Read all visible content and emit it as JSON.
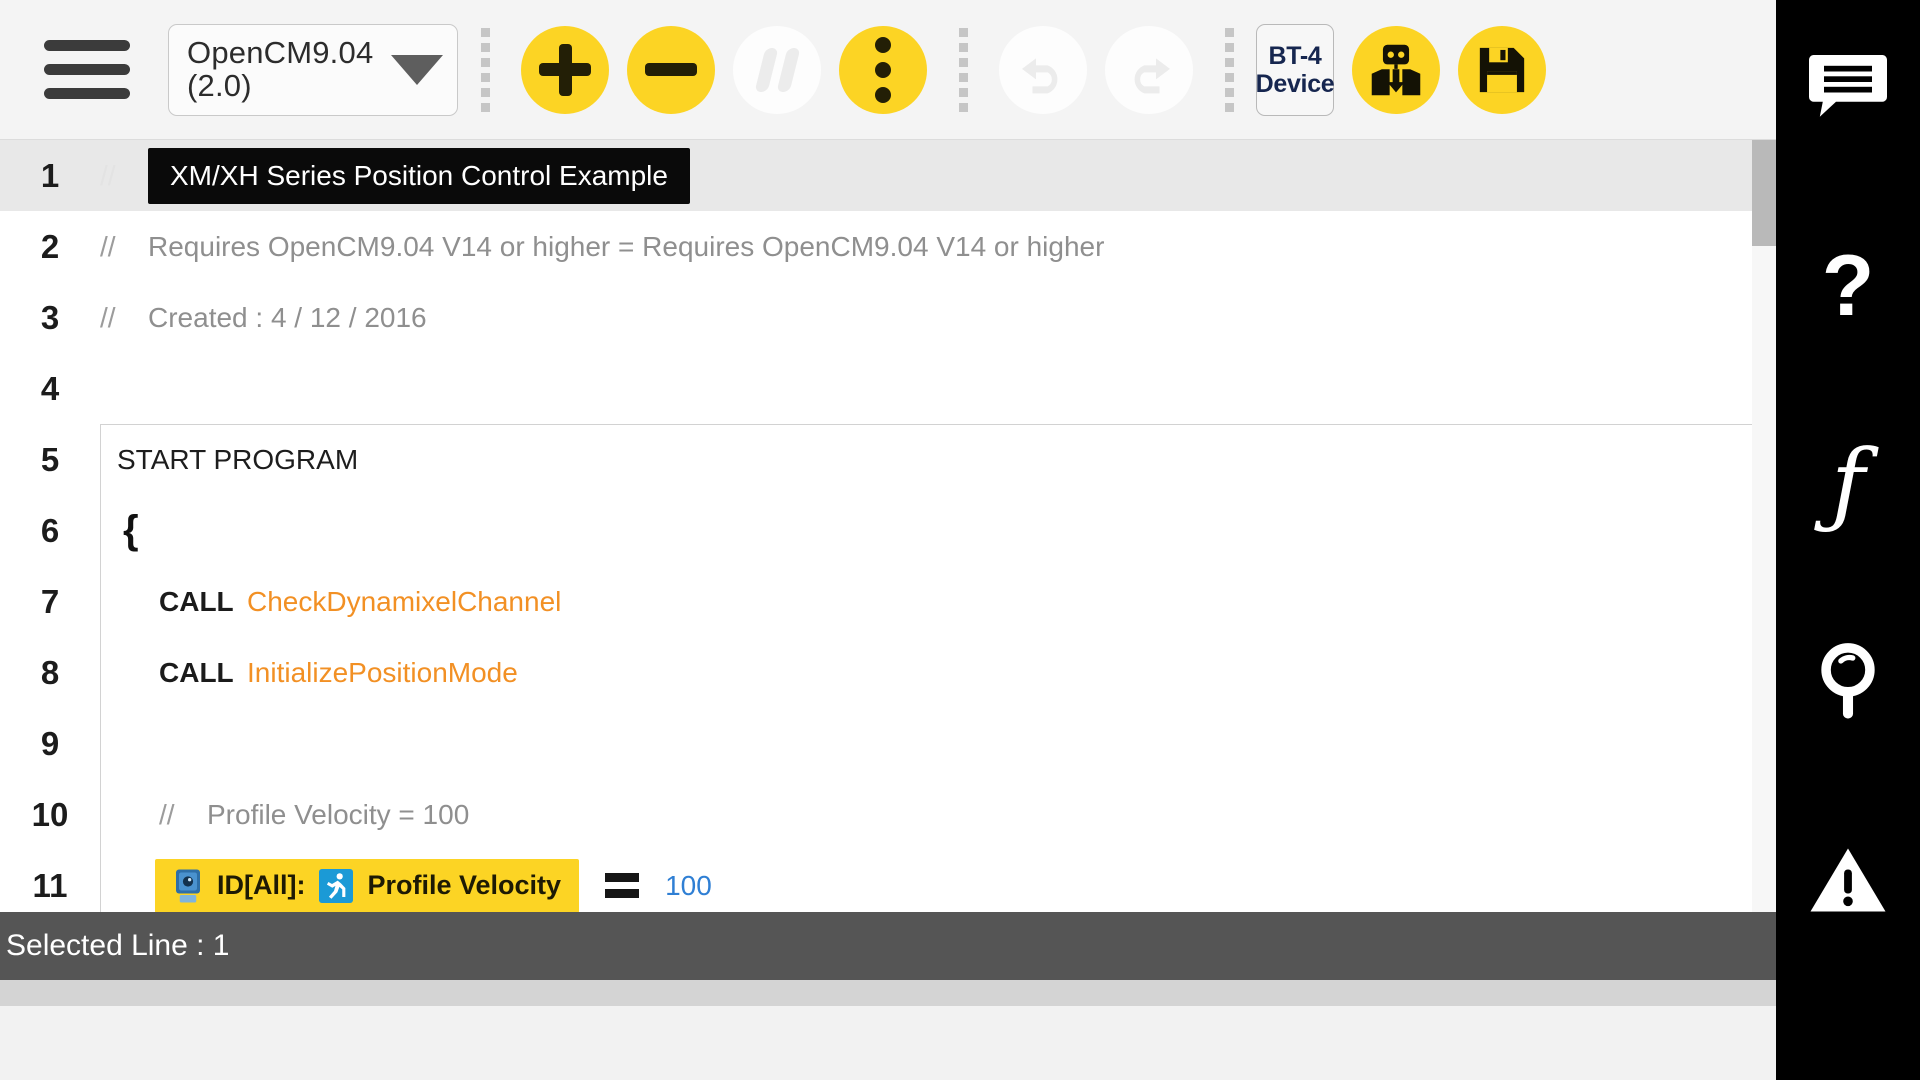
{
  "toolbar": {
    "menu_icon": "hamburger-menu-icon",
    "device": {
      "line1": "OpenCM9.04",
      "line2": "(2.0)",
      "caret_icon": "chevron-down-icon"
    },
    "buttons": [
      {
        "name": "add-line-button",
        "icon": "plus-icon",
        "state": "enabled"
      },
      {
        "name": "remove-line-button",
        "icon": "minus-icon",
        "state": "enabled"
      },
      {
        "name": "comment-line-button",
        "icon": "comment-slashes-icon",
        "state": "disabled"
      },
      {
        "name": "more-options-button",
        "icon": "kebab-menu-icon",
        "state": "enabled"
      },
      {
        "name": "undo-button",
        "icon": "undo-arrow-icon",
        "state": "disabled"
      },
      {
        "name": "redo-button",
        "icon": "redo-arrow-icon",
        "state": "disabled"
      }
    ],
    "bt_device": {
      "line1": "BT-4",
      "line2": "Device"
    },
    "download_button": {
      "icon": "robot-download-icon"
    },
    "save_button": {
      "icon": "floppy-disk-save-icon"
    },
    "colors": {
      "accent_yellow": "#fcd424",
      "toolbar_bg": "#f4f4f4",
      "navy": "#16264f"
    }
  },
  "editor": {
    "comment_marker": "//",
    "lines": [
      {
        "num": "1",
        "type": "selected-comment",
        "marker": "//",
        "text": "XM/XH Series Position Control Example"
      },
      {
        "num": "2",
        "type": "comment",
        "marker": "//",
        "text": "Requires OpenCM9.04 V14 or higher = Requires OpenCM9.04 V14 or higher"
      },
      {
        "num": "3",
        "type": "comment",
        "marker": "//",
        "text": "Created : 4 / 12 / 2016"
      },
      {
        "num": "4",
        "type": "blank",
        "text": ""
      },
      {
        "num": "5",
        "type": "keyword",
        "text": "START PROGRAM"
      },
      {
        "num": "6",
        "type": "brace",
        "text": "{"
      },
      {
        "num": "7",
        "type": "call",
        "keyword": "CALL",
        "text": "CheckDynamixelChannel"
      },
      {
        "num": "8",
        "type": "call",
        "keyword": "CALL",
        "text": "InitializePositionMode"
      },
      {
        "num": "9",
        "type": "blank",
        "text": ""
      },
      {
        "num": "10",
        "type": "comment",
        "marker": "//",
        "text": "Profile Velocity = 100"
      },
      {
        "num": "11",
        "type": "statement",
        "id_label": "ID[All]:",
        "param": "Profile Velocity",
        "operator": "=",
        "value": "100",
        "servo_icon": "dynamixel-servo-icon",
        "param_icon": "running-person-icon"
      }
    ],
    "colors": {
      "function_orange": "#f29024",
      "number_blue": "#2f7fd4",
      "comment_gray": "#8f8f8f",
      "selection_black": "#0a0a0a"
    }
  },
  "status": {
    "text": "Selected Line : 1"
  },
  "sidebar": {
    "items": [
      {
        "name": "comment-panel-button",
        "icon": "speech-bubble-icon"
      },
      {
        "name": "help-panel-button",
        "icon": "question-mark-icon",
        "glyph": "?"
      },
      {
        "name": "function-panel-button",
        "icon": "function-f-icon",
        "glyph": "ƒ"
      },
      {
        "name": "search-panel-button",
        "icon": "magnifier-icon"
      },
      {
        "name": "warning-panel-button",
        "icon": "warning-triangle-icon"
      }
    ]
  }
}
